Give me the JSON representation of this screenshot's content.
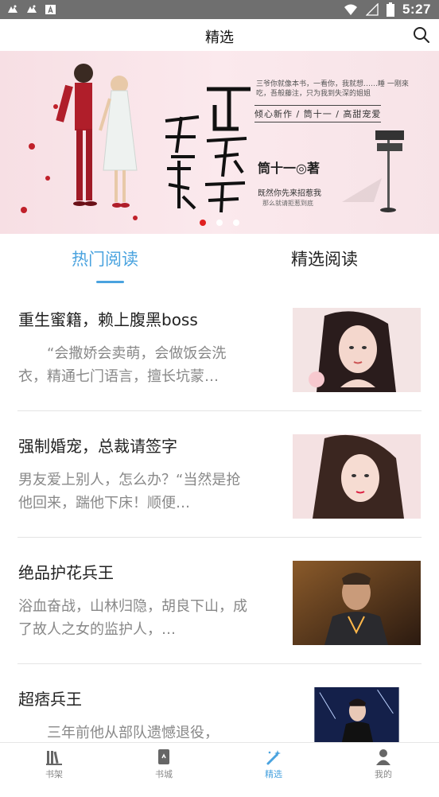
{
  "status_bar": {
    "time": "5:27",
    "left_icons": [
      "notification-icon",
      "notification-icon",
      "a-box-icon"
    ],
    "right_icons": [
      "wifi-icon",
      "signal-icon",
      "battery-icon"
    ]
  },
  "header": {
    "title": "精选"
  },
  "banner": {
    "tagline": "三爷你就像本书，一看你，我就想……睡 一刚來吃，吾般藤注，只为我到失深的姐姐",
    "newwork": "倾心新作 / 筒十一 / 高甜宠爱",
    "big_title": "可不可以爱上我",
    "author": "筒十一◎著",
    "subline1": "既然你先来招惹我",
    "subline2": "那么就请拒惹到底",
    "slide_count": 3,
    "active_slide": 0
  },
  "tabs": [
    {
      "label": "热门阅读",
      "active": true
    },
    {
      "label": "精选阅读",
      "active": false
    }
  ],
  "books": [
    {
      "title": "重生蜜籍，赖上腹黑boss",
      "desc": "　　“会撒娇会卖萌，会做饭会洗衣，精通七门语言，擅长坑蒙…"
    },
    {
      "title": "强制婚宠，总裁请签字",
      "desc": "男友爱上别人，怎么办？“当然是抢他回来，踹他下床！顺便…"
    },
    {
      "title": "绝品护花兵王",
      "desc": "浴血奋战，山林归隐，胡良下山，成了故人之女的监护人，…"
    },
    {
      "title": "超痞兵王",
      "desc": "　　三年前他从部队遗憾退役，"
    }
  ],
  "bottom_nav": [
    {
      "label": "书架",
      "icon": "bookshelf-icon",
      "active": false
    },
    {
      "label": "书城",
      "icon": "book-store-icon",
      "active": false
    },
    {
      "label": "精选",
      "icon": "magic-wand-icon",
      "active": true
    },
    {
      "label": "我的",
      "icon": "person-icon",
      "active": false
    }
  ],
  "colors": {
    "accent": "#4aa3df",
    "status_bar": "#6f6f6f",
    "dot_active": "#e02020"
  }
}
